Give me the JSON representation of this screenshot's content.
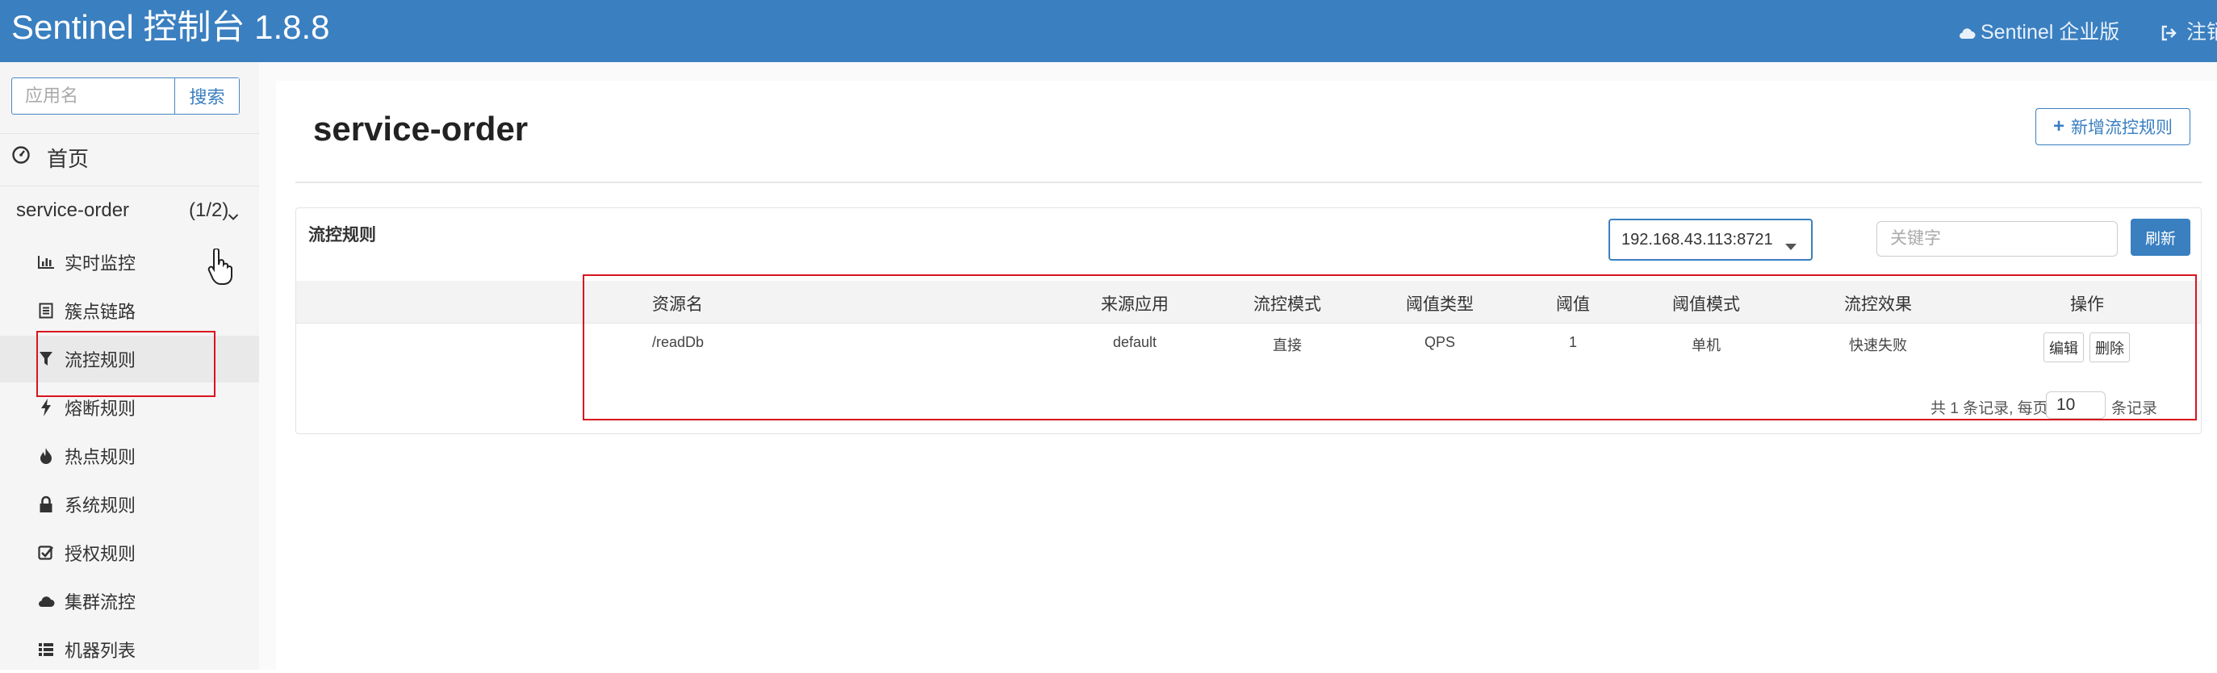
{
  "header": {
    "brand": "Sentinel 控制台 1.8.8",
    "enterprise_label": "Sentinel 企业版",
    "logout_label": "注销",
    "background_color": "#3a7fc0"
  },
  "sidebar": {
    "search_placeholder": "应用名",
    "search_button": "搜索",
    "home_label": "首页",
    "app": {
      "name": "service-order",
      "count": "(1/2)"
    },
    "items": [
      {
        "label": "实时监控",
        "icon": "bar-chart-icon"
      },
      {
        "label": "簇点链路",
        "icon": "list-alt-icon"
      },
      {
        "label": "流控规则",
        "icon": "filter-icon",
        "active": true
      },
      {
        "label": "熔断规则",
        "icon": "flash-icon"
      },
      {
        "label": "热点规则",
        "icon": "fire-icon"
      },
      {
        "label": "系统规则",
        "icon": "lock-icon"
      },
      {
        "label": "授权规则",
        "icon": "check-icon"
      },
      {
        "label": "集群流控",
        "icon": "cloud-icon"
      },
      {
        "label": "机器列表",
        "icon": "th-list-icon"
      }
    ]
  },
  "main": {
    "title": "service-order",
    "add_button": "新增流控规则",
    "panel_title": "流控规则",
    "machine_selected": "192.168.43.113:8721",
    "keyword_placeholder": "关键字",
    "refresh_button": "刷新",
    "table": {
      "columns": [
        "资源名",
        "来源应用",
        "流控模式",
        "阈值类型",
        "阈值",
        "阈值模式",
        "流控效果",
        "操作"
      ],
      "rows": [
        {
          "resource": "/readDb",
          "limit_app": "default",
          "strategy": "直接",
          "grade": "QPS",
          "count": "1",
          "cluster_mode": "单机",
          "control_behavior": "快速失败",
          "edit": "编辑",
          "delete": "删除"
        }
      ]
    },
    "pager": {
      "prefix": "共 1 条记录, 每页",
      "page_size": "10",
      "suffix": "条记录"
    }
  },
  "colors": {
    "accent": "#3a7fc0",
    "highlight_box": "#d9141f"
  }
}
